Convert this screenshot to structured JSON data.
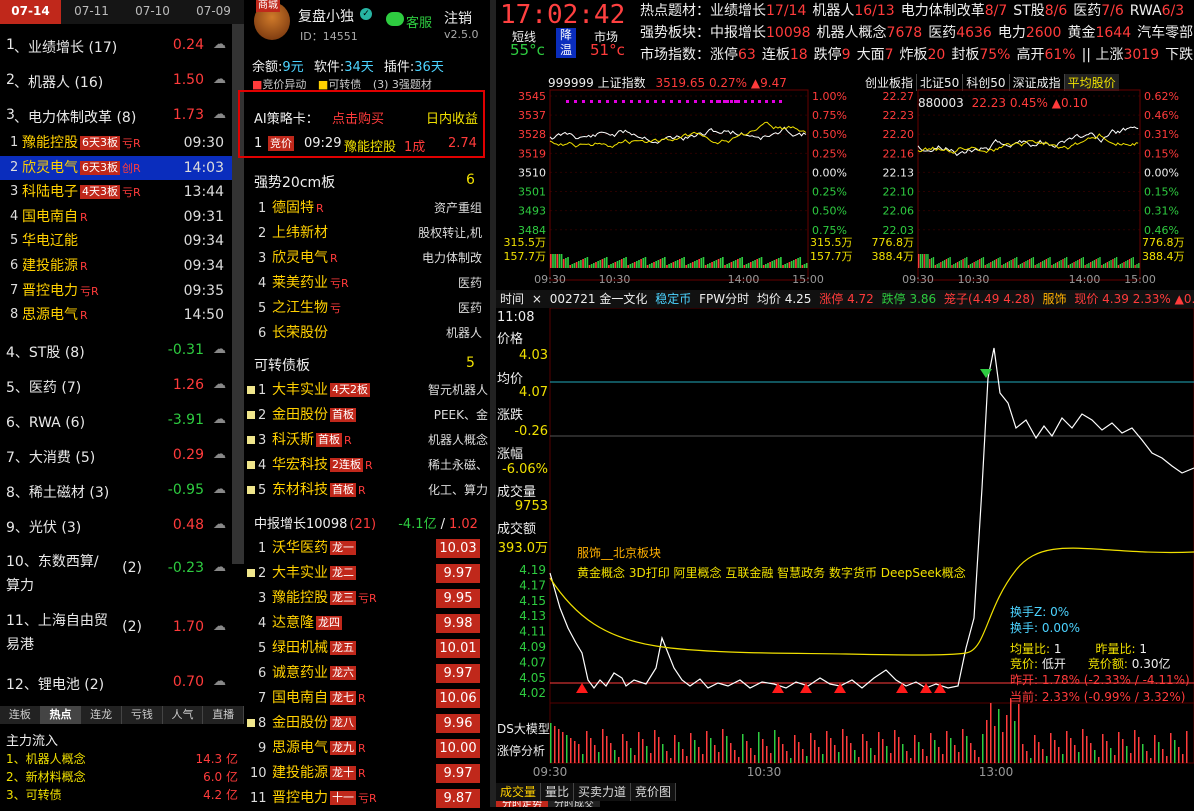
{
  "date_tabs": [
    "07-14",
    "07-11",
    "07-10",
    "07-09"
  ],
  "sectors": [
    {
      "rank": "1",
      "name": "业绩增长",
      "count": "(17)",
      "value": "0.24",
      "color": "r"
    },
    {
      "rank": "2",
      "name": "机器人",
      "count": "(16)",
      "value": "1.50",
      "color": "r"
    },
    {
      "rank": "3",
      "name": "电力体制改革",
      "count": "(8)",
      "value": "1.73",
      "color": "r"
    }
  ],
  "sector3_stocks": [
    {
      "idx": "1",
      "name": "豫能控股",
      "tag": "6天3板",
      "mark": "亏R",
      "time": "09:30"
    },
    {
      "idx": "2",
      "name": "欣灵电气",
      "tag": "6天3板",
      "mark": "创R",
      "time": "14:03"
    },
    {
      "idx": "3",
      "name": "科陆电子",
      "tag": "4天3板",
      "mark": "亏R",
      "time": "13:44"
    },
    {
      "idx": "4",
      "name": "国电南自",
      "tag": "",
      "mark": "R",
      "time": "09:31"
    },
    {
      "idx": "5",
      "name": "华电辽能",
      "tag": "",
      "mark": "",
      "time": "09:34"
    },
    {
      "idx": "6",
      "name": "建投能源",
      "tag": "",
      "mark": "R",
      "time": "09:34"
    },
    {
      "idx": "7",
      "name": "晋控电力",
      "tag": "",
      "mark": "亏R",
      "time": "09:35"
    },
    {
      "idx": "8",
      "name": "思源电气",
      "tag": "",
      "mark": "R",
      "time": "14:50"
    }
  ],
  "sectors_more": [
    {
      "rank": "4",
      "name": "ST股",
      "count": "(8)",
      "value": "-0.31",
      "color": "g"
    },
    {
      "rank": "5",
      "name": "医药",
      "count": "(7)",
      "value": "1.26",
      "color": "r"
    },
    {
      "rank": "6",
      "name": "RWA",
      "count": "(6)",
      "value": "-3.91",
      "color": "g"
    },
    {
      "rank": "7",
      "name": "大消费",
      "count": "(5)",
      "value": "0.29",
      "color": "r"
    },
    {
      "rank": "8",
      "name": "稀土磁材",
      "count": "(3)",
      "value": "-0.95",
      "color": "g"
    },
    {
      "rank": "9",
      "name": "光伏",
      "count": "(3)",
      "value": "0.48",
      "color": "r"
    },
    {
      "rank": "10",
      "name": "东数西算/算力",
      "count": "(2)",
      "value": "-0.23",
      "color": "g"
    },
    {
      "rank": "11",
      "name": "上海自由贸易港",
      "count": "(2)",
      "value": "1.70",
      "color": "r"
    },
    {
      "rank": "12",
      "name": "锂电池",
      "count": "(2)",
      "value": "0.70",
      "color": "r"
    }
  ],
  "bottom_tabs": [
    "连板",
    "热点",
    "连龙",
    "亏钱",
    "人气",
    "直播"
  ],
  "main_flow": {
    "title": "主力流入",
    "items": [
      {
        "name": "1、机器人概念",
        "value": "14.3 亿"
      },
      {
        "name": "2、新材料概念",
        "value": "6.0 亿"
      },
      {
        "name": "3、可转债",
        "value": "4.2 亿"
      }
    ]
  },
  "profile": {
    "name": "复盘小独",
    "id": "ID：14551",
    "service": "客服",
    "logout": "注销",
    "version": "v2.5.0",
    "badge": "商城"
  },
  "balance": {
    "items": [
      "余额:",
      "9元",
      "软件:",
      "34天",
      "插件:",
      "36天"
    ],
    "tags": [
      "竞价异动",
      "可转债",
      "(3) 3强题材"
    ]
  },
  "ai_card": {
    "title": "AI策略卡：",
    "buy": "点击购买",
    "intraday": "日内收益",
    "row_idx": "1",
    "row_tag": "竞价",
    "row_time": "09:29",
    "row_name": "豫能控股",
    "row_val": "1成",
    "row_profit": "2.74"
  },
  "strong20": {
    "title": "强势20cm板",
    "count": "6",
    "rows": [
      {
        "idx": "1",
        "name": "德固特",
        "mark": "R",
        "desc": "资产重组"
      },
      {
        "idx": "2",
        "name": "上纬新材",
        "mark": "",
        "desc": "股权转让,机"
      },
      {
        "idx": "3",
        "name": "欣灵电气",
        "mark": "R",
        "desc": "电力体制改"
      },
      {
        "idx": "4",
        "name": "莱美药业",
        "mark": "亏R",
        "desc": "医药"
      },
      {
        "idx": "5",
        "name": "之江生物",
        "mark": "亏",
        "desc": "医药"
      },
      {
        "idx": "6",
        "name": "长荣股份",
        "mark": "",
        "desc": "机器人"
      }
    ]
  },
  "convbond": {
    "title": "可转债板",
    "count": "5",
    "rows": [
      {
        "idx": "1",
        "name": "大丰实业",
        "tag": "4天2板",
        "mark": "",
        "desc": "智元机器人"
      },
      {
        "idx": "2",
        "name": "金田股份",
        "tag": "首板",
        "mark": "",
        "desc": "PEEK、金"
      },
      {
        "idx": "3",
        "name": "科沃斯",
        "tag": "首板",
        "mark": "R",
        "desc": "机器人概念"
      },
      {
        "idx": "4",
        "name": "华宏科技",
        "tag": "2连板",
        "mark": "R",
        "desc": "稀土永磁、"
      },
      {
        "idx": "5",
        "name": "东材科技",
        "tag": "首板",
        "mark": "R",
        "desc": "化工、算力"
      }
    ]
  },
  "growth": {
    "title": "中报增长",
    "num": "10098",
    "count": "(21)",
    "flow": "-4.1亿",
    "sep": "/",
    "pct": "1.02",
    "rows": [
      {
        "idx": "1",
        "name": "沃华医药",
        "tag": "龙一",
        "mark": "",
        "value": "10.03",
        "dot": false
      },
      {
        "idx": "2",
        "name": "大丰实业",
        "tag": "龙二",
        "mark": "",
        "value": "9.97",
        "dot": true
      },
      {
        "idx": "3",
        "name": "豫能控股",
        "tag": "龙三",
        "mark": "亏R",
        "value": "9.95",
        "dot": false
      },
      {
        "idx": "4",
        "name": "达意隆",
        "tag": "龙四",
        "mark": "",
        "value": "9.98",
        "dot": false
      },
      {
        "idx": "5",
        "name": "绿田机械",
        "tag": "龙五",
        "mark": "",
        "value": "10.01",
        "dot": false
      },
      {
        "idx": "6",
        "name": "诚意药业",
        "tag": "龙六",
        "mark": "",
        "value": "9.97",
        "dot": false
      },
      {
        "idx": "7",
        "name": "国电南自",
        "tag": "龙七",
        "mark": "R",
        "value": "10.06",
        "dot": false
      },
      {
        "idx": "8",
        "name": "金田股份",
        "tag": "龙八",
        "mark": "",
        "value": "9.96",
        "dot": true
      },
      {
        "idx": "9",
        "name": "思源电气",
        "tag": "龙九",
        "mark": "R",
        "value": "10.00",
        "dot": false
      },
      {
        "idx": "10",
        "name": "建投能源",
        "tag": "龙十",
        "mark": "R",
        "value": "9.97",
        "dot": false
      },
      {
        "idx": "11",
        "name": "晋控电力",
        "tag": "十一",
        "mark": "亏R",
        "value": "9.87",
        "dot": false
      }
    ]
  },
  "clock": {
    "time": "17:02:42",
    "short_label": "短线",
    "short_temp": "55°c",
    "down": "降",
    "temp": "温",
    "market_label": "市场",
    "market_temp": "51°c"
  },
  "header": {
    "row1_label": "热点题材：",
    "row1": [
      [
        "业绩增长",
        "17/14"
      ],
      [
        "机器人",
        "16/13"
      ],
      [
        "电力体制改革",
        "8/7"
      ],
      [
        "ST股",
        "8/6"
      ],
      [
        "医药",
        "7/6"
      ],
      [
        "RWA",
        "6/3"
      ]
    ],
    "row2_label": "强势板块：",
    "row2": [
      [
        "中报增长",
        "10098"
      ],
      [
        "机器人概念",
        "7678"
      ],
      [
        "医药",
        "4636"
      ],
      [
        "电力",
        "2600"
      ],
      [
        "黄金",
        "1644"
      ],
      [
        "汽车零部",
        ""
      ]
    ],
    "row3_label": "市场指数：",
    "row3": [
      [
        "涨停",
        "63"
      ],
      [
        "连板",
        "18"
      ],
      [
        "跌停",
        "9"
      ],
      [
        "大面",
        "7"
      ],
      [
        "炸板",
        "20"
      ],
      [
        "封板",
        "75%"
      ],
      [
        "高开",
        "61%"
      ],
      [
        "|| 上涨",
        "3019"
      ],
      [
        "下跌",
        ""
      ]
    ]
  },
  "sh_chart": {
    "code": "999999",
    "name": "上证指数",
    "value": "3519.65",
    "pct": "0.27%",
    "chg": "▲9.47",
    "ylabels": [
      "3545",
      "3537",
      "3528",
      "3519",
      "3510",
      "3501",
      "3493",
      "3484"
    ],
    "rlabels": [
      "1.00%",
      "0.75%",
      "0.50%",
      "0.25%",
      "0.00%",
      "0.25%",
      "0.50%",
      "0.75%"
    ],
    "vol": [
      "315.5万",
      "157.7万"
    ],
    "x": [
      "09:30",
      "10:30",
      "14:00",
      "15:00"
    ]
  },
  "cy_chart": {
    "tabs": [
      "创业板指",
      "北证50",
      "科创50",
      "深证成指",
      "平均股价"
    ],
    "code": "880003",
    "value": "22.23",
    "pct": "0.45%",
    "chg": "▲0.10",
    "ylabels": [
      "22.27",
      "22.23",
      "22.20",
      "22.16",
      "22.13",
      "22.10",
      "22.06",
      "22.03"
    ],
    "rlabels": [
      "0.62%",
      "0.46%",
      "0.31%",
      "0.15%",
      "0.00%",
      "0.15%",
      "0.31%",
      "0.46%"
    ],
    "vol": [
      "776.8万",
      "388.4万"
    ],
    "x": [
      "09:30",
      "10:30",
      "14:00",
      "15:00"
    ]
  },
  "main_chart": {
    "tab_time": "时间",
    "close": "×",
    "code": "002721",
    "name": "金一文化",
    "tag1": "稳定币",
    "tag2": "FPW分时",
    "avg": "均价 4.25",
    "limit_up": "涨停 4.72",
    "limit_down": "跌停 3.86",
    "bid": "笼子(4.49 4.28)",
    "sector": "服饰",
    "price": "现价 4.39",
    "pct": "2.33%",
    "chg": "▲0.10",
    "vol": "现量",
    "side": [
      [
        "11:08",
        "w"
      ],
      [
        "价格",
        "w"
      ],
      [
        "4.03",
        "y"
      ],
      [
        "均价",
        "w"
      ],
      [
        "4.07",
        "y"
      ],
      [
        "涨跌",
        "w"
      ],
      [
        "-0.26",
        "y"
      ],
      [
        "涨幅",
        "w"
      ],
      [
        "-6.06%",
        "y"
      ],
      [
        "成交量",
        "w"
      ],
      [
        "9753",
        "y"
      ],
      [
        "成交额",
        "w"
      ],
      [
        "393.0万",
        "y"
      ]
    ],
    "sector_text": "服饰__北京板块",
    "concepts": "黄金概念 3D打印 阿里概念 互联金融 智慧政务 数字货币 DeepSeek概念",
    "ylabels": [
      "4.19",
      "4.17",
      "4.15",
      "4.13",
      "4.11",
      "4.09",
      "4.07",
      "4.05",
      "4.02"
    ],
    "info": [
      [
        "换手Z:",
        "0%"
      ],
      [
        "换手:",
        "0.00%"
      ],
      [
        "均量比:",
        "1",
        "昨量比:",
        "1"
      ],
      [
        "竞价:",
        "低开",
        "竞价额:",
        "0.30亿"
      ]
    ],
    "yest": "昨开: 1.78% (-2.33% / -4.11%)",
    "now": "当前: 2.33% (-0.99% / 3.32%)",
    "ds_label1": "DS大模型",
    "ds_label2": "涨停分析",
    "x": [
      "09:30",
      "10:30",
      "13:00"
    ],
    "tabs": [
      "成交量",
      "量比",
      "买卖力道",
      "竞价图"
    ],
    "subtabs_b": [
      "分时走势",
      "分时成交"
    ]
  }
}
